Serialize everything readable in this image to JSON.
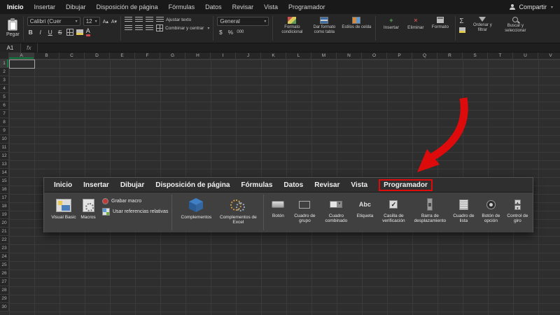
{
  "colors": {
    "annotation_red": "#dd0b0b",
    "excel_green": "#107c41"
  },
  "menubar": {
    "tabs": [
      "Inicio",
      "Insertar",
      "Dibujar",
      "Disposición de página",
      "Fórmulas",
      "Datos",
      "Revisar",
      "Vista",
      "Programador"
    ],
    "share": "Compartir"
  },
  "icons": {
    "bold": "B",
    "italic": "I",
    "underline": "U",
    "strike": "S",
    "sum": "Σ",
    "currency": "$",
    "percent": "%",
    "zeros": "000",
    "fx": "fx",
    "abc": "Abc",
    "caret": "▾",
    "inc_font": "A▴",
    "dec_font": "A▾",
    "check": "✓",
    "spin_up": "▲",
    "spin_down": "▼"
  },
  "ribbon": {
    "paste": "Pegar",
    "font_name": "Calibri (Cuer",
    "font_size": "12",
    "wrap_text": "Ajustar texto",
    "merge_center": "Combinar y centrar",
    "number_format": "General",
    "conditional_format": "Formato condicional",
    "format_as_table": "Dar formato como tabla",
    "cell_styles": "Estilos de celda",
    "insert": "Insertar",
    "delete": "Eliminar",
    "format": "Formato",
    "sort_filter": "Ordenar y filtrar",
    "find_select": "Buscar y seleccionar"
  },
  "formula_bar": {
    "name_box": "A1"
  },
  "grid": {
    "columns": [
      "A",
      "B",
      "C",
      "D",
      "E",
      "F",
      "G",
      "H",
      "I",
      "J",
      "K",
      "L",
      "M",
      "N",
      "O",
      "P",
      "Q",
      "R",
      "S",
      "T",
      "U",
      "V"
    ],
    "rows": [
      "1",
      "2",
      "3",
      "4",
      "5",
      "6",
      "7",
      "8",
      "9",
      "10",
      "11",
      "12",
      "13",
      "14",
      "15",
      "16",
      "17",
      "18",
      "19",
      "20",
      "21",
      "22",
      "23",
      "24",
      "25",
      "26",
      "27",
      "28",
      "29",
      "30"
    ]
  },
  "overlay": {
    "tabs": [
      "Inicio",
      "Insertar",
      "Dibujar",
      "Disposición de página",
      "Fórmulas",
      "Datos",
      "Revisar",
      "Vista",
      "Programador"
    ],
    "highlighted_tab": "Programador",
    "code_group": {
      "visual_basic": "Visual Basic",
      "macros": "Macros",
      "record_macro": "Grabar macro",
      "relative_refs": "Usar referencias relativas"
    },
    "addins_group": {
      "addins": "Complementos",
      "excel_addins": "Complementos de Excel"
    },
    "controls_group": [
      "Botón",
      "Cuadro de grupo",
      "Cuadro combinado",
      "Etiqueta",
      "Casilla de verificación",
      "Barra de desplazamiento",
      "Cuadro de lista",
      "Botón de opción",
      "Control de giro"
    ]
  }
}
